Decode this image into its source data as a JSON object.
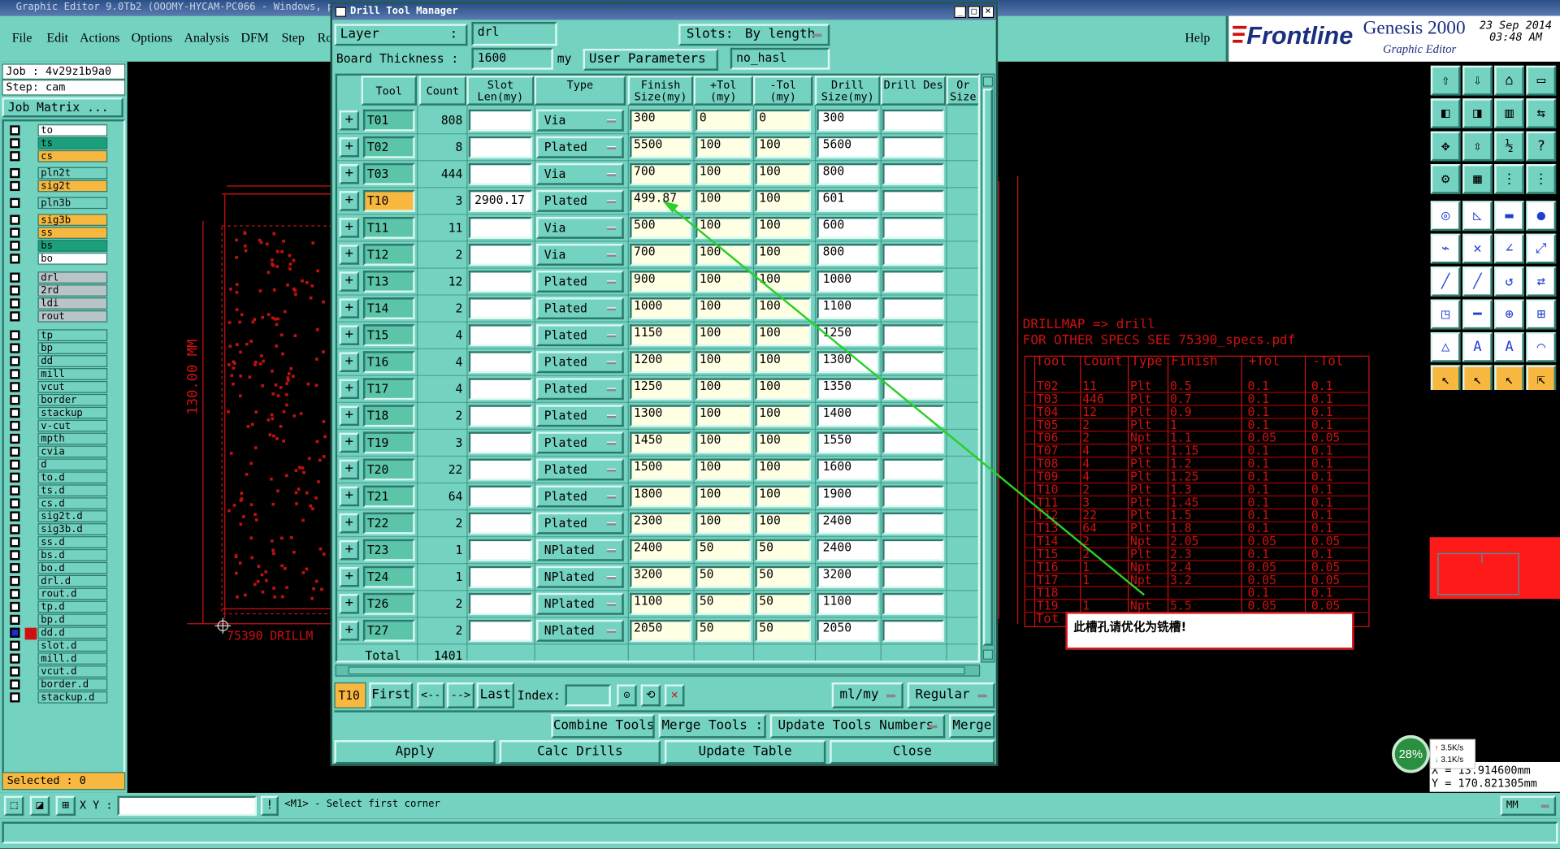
{
  "app": {
    "title": "Graphic Editor 9.0Tb2 (OOOMY-HYCAM-PC066 - Windows, pid",
    "menu": [
      "File",
      "Edit",
      "Actions",
      "Options",
      "Analysis",
      "DFM",
      "Step",
      "Ro"
    ],
    "help": "Help",
    "brand": "Frontline",
    "product": "Genesis 2000",
    "product_sub": "Graphic Editor",
    "date": "23 Sep 2014",
    "time": "03:48 AM"
  },
  "left_panel": {
    "job": "Job : 4v29z1b9a0",
    "step": "Step: cam",
    "job_matrix": "Job Matrix ...",
    "selected": "Selected : 0",
    "layers": [
      {
        "name": "to",
        "color": "#ffffff"
      },
      {
        "name": "ts",
        "color": "#1aa07a"
      },
      {
        "name": "cs",
        "color": "#f8b840"
      },
      {
        "name": "pln2t",
        "color": "#74d2c0"
      },
      {
        "name": "sig2t",
        "color": "#f8b840"
      },
      {
        "name": "pln3b",
        "color": "#74d2c0"
      },
      {
        "name": "sig3b",
        "color": "#f8b840"
      },
      {
        "name": "ss",
        "color": "#f8b840"
      },
      {
        "name": "bs",
        "color": "#1aa07a"
      },
      {
        "name": "bo",
        "color": "#ffffff"
      },
      {
        "name": "drl",
        "color": "#b8c4c8"
      },
      {
        "name": "2rd",
        "color": "#b8c4c8"
      },
      {
        "name": "ldi",
        "color": "#b8c4c8"
      },
      {
        "name": "rout",
        "color": "#b8c4c8"
      },
      {
        "name": "tp",
        "color": "#74d2c0"
      },
      {
        "name": "bp",
        "color": "#74d2c0"
      },
      {
        "name": "dd",
        "color": "#74d2c0"
      },
      {
        "name": "mill",
        "color": "#74d2c0"
      },
      {
        "name": "vcut",
        "color": "#74d2c0"
      },
      {
        "name": "border",
        "color": "#74d2c0"
      },
      {
        "name": "stackup",
        "color": "#74d2c0"
      },
      {
        "name": "v-cut",
        "color": "#74d2c0"
      },
      {
        "name": "mpth",
        "color": "#74d2c0"
      },
      {
        "name": "cvia",
        "color": "#74d2c0"
      },
      {
        "name": "d",
        "color": "#74d2c0"
      },
      {
        "name": "to.d",
        "color": "#74d2c0"
      },
      {
        "name": "ts.d",
        "color": "#74d2c0"
      },
      {
        "name": "cs.d",
        "color": "#74d2c0"
      },
      {
        "name": "sig2t.d",
        "color": "#74d2c0"
      },
      {
        "name": "sig3b.d",
        "color": "#74d2c0"
      },
      {
        "name": "ss.d",
        "color": "#74d2c0"
      },
      {
        "name": "bs.d",
        "color": "#74d2c0"
      },
      {
        "name": "bo.d",
        "color": "#74d2c0"
      },
      {
        "name": "drl.d",
        "color": "#74d2c0"
      },
      {
        "name": "rout.d",
        "color": "#74d2c0"
      },
      {
        "name": "tp.d",
        "color": "#74d2c0"
      },
      {
        "name": "bp.d",
        "color": "#74d2c0"
      },
      {
        "name": "dd.d",
        "color": "#74d2c0"
      },
      {
        "name": "slot.d",
        "color": "#74d2c0"
      },
      {
        "name": "mill.d",
        "color": "#74d2c0"
      },
      {
        "name": "vcut.d",
        "color": "#74d2c0"
      },
      {
        "name": "border.d",
        "color": "#74d2c0"
      },
      {
        "name": "stackup.d",
        "color": "#74d2c0"
      }
    ]
  },
  "canvas": {
    "dim_vertical": "130.00 MM",
    "label_bottom": "75390 DRILLM",
    "drillmap_title": "DRILLMAP => drill",
    "drillmap_note": "FOR OTHER SPECS SEE 75390_specs.pdf",
    "drillmap_headers": [
      "Tool",
      "Count",
      "Type",
      "Finish",
      "+Tol",
      "-Tol"
    ],
    "drillmap_rows": [
      [
        "T02",
        "11",
        "Plt",
        "0.5",
        "0.1",
        "0.1"
      ],
      [
        "T03",
        "446",
        "Plt",
        "0.7",
        "0.1",
        "0.1"
      ],
      [
        "T04",
        "12",
        "Plt",
        "0.9",
        "0.1",
        "0.1"
      ],
      [
        "T05",
        "2",
        "Plt",
        "1",
        "0.1",
        "0.1"
      ],
      [
        "T06",
        "2",
        "Npt",
        "1.1",
        "0.05",
        "0.05"
      ],
      [
        "T07",
        "4",
        "Plt",
        "1.15",
        "0.1",
        "0.1"
      ],
      [
        "T08",
        "4",
        "Plt",
        "1.2",
        "0.1",
        "0.1"
      ],
      [
        "T09",
        "4",
        "Plt",
        "1.25",
        "0.1",
        "0.1"
      ],
      [
        "T10",
        "2",
        "Plt",
        "1.3",
        "0.1",
        "0.1"
      ],
      [
        "T11",
        "3",
        "Plt",
        "1.45",
        "0.1",
        "0.1"
      ],
      [
        "T12",
        "22",
        "Plt",
        "1.5",
        "0.1",
        "0.1"
      ],
      [
        "T13",
        "64",
        "Plt",
        "1.8",
        "0.1",
        "0.1"
      ],
      [
        "T14",
        "2",
        "Npt",
        "2.05",
        "0.05",
        "0.05"
      ],
      [
        "T15",
        "2",
        "Plt",
        "2.3",
        "0.1",
        "0.1"
      ],
      [
        "T16",
        "1",
        "Npt",
        "2.4",
        "0.05",
        "0.05"
      ],
      [
        "T17",
        "1",
        "Npt",
        "3.2",
        "0.05",
        "0.05"
      ],
      [
        "T18",
        "",
        "",
        "",
        "0.1",
        "0.1"
      ],
      [
        "T19",
        "1",
        "Npt",
        "5.5",
        "0.05",
        "0.05"
      ]
    ],
    "drillmap_footer": "Tot",
    "callout": "此槽孔请优化为铣槽!",
    "coord_x": "X = 13.914600mm",
    "coord_y": "Y = 170.821305mm",
    "net_percent": "28%",
    "net_up": "3.5K/s",
    "net_down": "3.1K/s"
  },
  "dialog": {
    "title": "Drill Tool Manager",
    "layer_label": "Layer",
    "layer_value": "drl",
    "slots_label": "Slots:",
    "slots_value": "By length",
    "board_thickness_label": "Board Thickness :",
    "board_thickness_value": "1600",
    "board_thickness_unit": "my",
    "user_params_label": "User Parameters :",
    "user_params_value": "no_hasl",
    "columns": [
      "Tool",
      "Count",
      "Slot Len(my)",
      "Type",
      "Finish Size(my)",
      "+Tol (my)",
      "-Tol (my)",
      "Drill Size(my)",
      "Drill Des",
      "Or Size"
    ],
    "rows": [
      {
        "tool": "T01",
        "count": "808",
        "slot": "",
        "type": "Via",
        "finish": "300",
        "ptol": "0",
        "mtol": "0",
        "drill": "300"
      },
      {
        "tool": "T02",
        "count": "8",
        "slot": "",
        "type": "Plated",
        "finish": "5500",
        "ptol": "100",
        "mtol": "100",
        "drill": "5600"
      },
      {
        "tool": "T03",
        "count": "444",
        "slot": "",
        "type": "Via",
        "finish": "700",
        "ptol": "100",
        "mtol": "100",
        "drill": "800"
      },
      {
        "tool": "T10",
        "count": "3",
        "slot": "2900.17",
        "type": "Plated",
        "finish": "499.87",
        "ptol": "100",
        "mtol": "100",
        "drill": "601"
      },
      {
        "tool": "T11",
        "count": "11",
        "slot": "",
        "type": "Via",
        "finish": "500",
        "ptol": "100",
        "mtol": "100",
        "drill": "600"
      },
      {
        "tool": "T12",
        "count": "2",
        "slot": "",
        "type": "Via",
        "finish": "700",
        "ptol": "100",
        "mtol": "100",
        "drill": "800"
      },
      {
        "tool": "T13",
        "count": "12",
        "slot": "",
        "type": "Plated",
        "finish": "900",
        "ptol": "100",
        "mtol": "100",
        "drill": "1000"
      },
      {
        "tool": "T14",
        "count": "2",
        "slot": "",
        "type": "Plated",
        "finish": "1000",
        "ptol": "100",
        "mtol": "100",
        "drill": "1100"
      },
      {
        "tool": "T15",
        "count": "4",
        "slot": "",
        "type": "Plated",
        "finish": "1150",
        "ptol": "100",
        "mtol": "100",
        "drill": "1250"
      },
      {
        "tool": "T16",
        "count": "4",
        "slot": "",
        "type": "Plated",
        "finish": "1200",
        "ptol": "100",
        "mtol": "100",
        "drill": "1300"
      },
      {
        "tool": "T17",
        "count": "4",
        "slot": "",
        "type": "Plated",
        "finish": "1250",
        "ptol": "100",
        "mtol": "100",
        "drill": "1350"
      },
      {
        "tool": "T18",
        "count": "2",
        "slot": "",
        "type": "Plated",
        "finish": "1300",
        "ptol": "100",
        "mtol": "100",
        "drill": "1400"
      },
      {
        "tool": "T19",
        "count": "3",
        "slot": "",
        "type": "Plated",
        "finish": "1450",
        "ptol": "100",
        "mtol": "100",
        "drill": "1550"
      },
      {
        "tool": "T20",
        "count": "22",
        "slot": "",
        "type": "Plated",
        "finish": "1500",
        "ptol": "100",
        "mtol": "100",
        "drill": "1600"
      },
      {
        "tool": "T21",
        "count": "64",
        "slot": "",
        "type": "Plated",
        "finish": "1800",
        "ptol": "100",
        "mtol": "100",
        "drill": "1900"
      },
      {
        "tool": "T22",
        "count": "2",
        "slot": "",
        "type": "Plated",
        "finish": "2300",
        "ptol": "100",
        "mtol": "100",
        "drill": "2400"
      },
      {
        "tool": "T23",
        "count": "1",
        "slot": "",
        "type": "NPlated",
        "finish": "2400",
        "ptol": "50",
        "mtol": "50",
        "drill": "2400"
      },
      {
        "tool": "T24",
        "count": "1",
        "slot": "",
        "type": "NPlated",
        "finish": "3200",
        "ptol": "50",
        "mtol": "50",
        "drill": "3200"
      },
      {
        "tool": "T26",
        "count": "2",
        "slot": "",
        "type": "NPlated",
        "finish": "1100",
        "ptol": "50",
        "mtol": "50",
        "drill": "1100"
      },
      {
        "tool": "T27",
        "count": "2",
        "slot": "",
        "type": "NPlated",
        "finish": "2050",
        "ptol": "50",
        "mtol": "50",
        "drill": "2050"
      }
    ],
    "total_label": "Total",
    "total_value": "1401",
    "current_tool": "T10",
    "nav_first": "First",
    "nav_prev": "<--",
    "nav_next": "-->",
    "nav_last": "Last",
    "index_label": "Index:",
    "units": "ml/my",
    "mode": "Regular",
    "combine_tools": "Combine Tools",
    "merge_tools": "Merge Tools :",
    "update_tools_numbers": "Update Tools Numbers",
    "merge": "Merge",
    "apply": "Apply",
    "calc_drills": "Calc Drills",
    "update_table": "Update Table",
    "close": "Close"
  },
  "statusbar": {
    "xy_label": "X Y :",
    "prompt": "<M1> - Select first corner",
    "units": "MM"
  }
}
